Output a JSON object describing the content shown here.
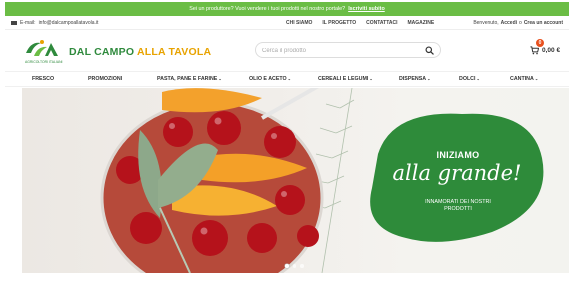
{
  "promo": {
    "text": "Sei un produttore? Vuoi vendere i tuoi prodotti nel nostro portale?",
    "cta": "Iscriviti subito"
  },
  "topbar": {
    "email_label": "E-mail:",
    "email": "info@dalcampoallatavola.it",
    "links": [
      "CHI SIAMO",
      "IL PROGETTO",
      "CONTATTACI",
      "MAGAZINE"
    ],
    "greeting": "Benvenuto,",
    "login": "Accedi",
    "separator": "o",
    "signup": "Crea un account"
  },
  "header": {
    "logo_sub": "AGRICOLTORI ITALIANI",
    "brand_part1": "DAL CAMPO",
    "brand_part2": "ALLA TAVOLA",
    "search_placeholder": "Cerca il prodotto",
    "cart_count": "0",
    "cart_total": "0,00 €"
  },
  "nav": {
    "items": [
      {
        "label": "FRESCO",
        "has_dropdown": false
      },
      {
        "label": "PROMOZIONI",
        "has_dropdown": false
      },
      {
        "label": "PASTA, PANE E FARINE",
        "has_dropdown": true
      },
      {
        "label": "OLIO E ACETO",
        "has_dropdown": true
      },
      {
        "label": "CEREALI E LEGUMI",
        "has_dropdown": true
      },
      {
        "label": "DISPENSA",
        "has_dropdown": true
      },
      {
        "label": "DOLCI",
        "has_dropdown": true
      },
      {
        "label": "CANTINA",
        "has_dropdown": true
      }
    ],
    "chevron": "⌄"
  },
  "hero": {
    "headline1": "INIZIAMO",
    "headline2": "alla grande!",
    "subline": "INNAMORATI DEI NOSTRI PRODOTTI",
    "slides": 3,
    "active_slide": 1
  },
  "colors": {
    "promo_bar": "#6bbd45",
    "brand_green": "#2f8a3d",
    "brand_yellow": "#e8a300",
    "hero_blob": "#2e8b3a",
    "cart_badge": "#e8501e"
  }
}
